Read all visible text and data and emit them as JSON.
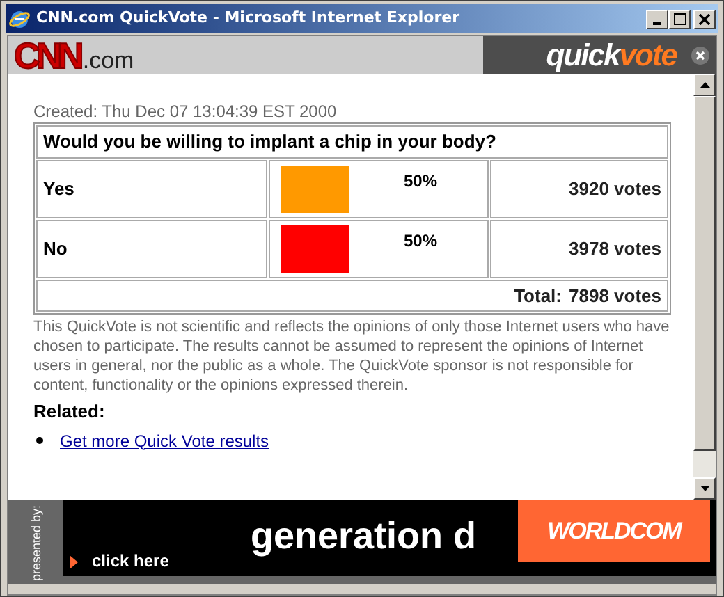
{
  "window": {
    "title": "CNN.com QuickVote - Microsoft Internet Explorer"
  },
  "header": {
    "site_logo": {
      "main": "CNN",
      "suffix": ".com"
    },
    "poll_logo": {
      "first": "quick",
      "second": "vote"
    }
  },
  "created": "Created: Thu Dec 07 13:04:39 EST 2000",
  "poll": {
    "question": "Would you be willing to implant a chip in your body?",
    "options": [
      {
        "label": "Yes",
        "percent": "50%",
        "color": "#ff9900",
        "votes": "3920 votes"
      },
      {
        "label": "No",
        "percent": "50%",
        "color": "#ff0000",
        "votes": "3978 votes"
      }
    ],
    "total_label": "Total:",
    "total": "7898 votes"
  },
  "disclaimer": "This QuickVote is not scientific and reflects the opinions of only those Internet users who have chosen to participate. The results cannot be assumed to represent the opinions of Internet users in general, nor the public as a whole. The QuickVote sponsor is not responsible for content, functionality or the opinions expressed therein.",
  "related": {
    "heading": "Related:",
    "links": [
      "Get more Quick Vote results"
    ]
  },
  "ad": {
    "presented_by": "presented by:",
    "click": "click here",
    "slogan": "generation d",
    "brand": "WORLDCOM"
  }
}
